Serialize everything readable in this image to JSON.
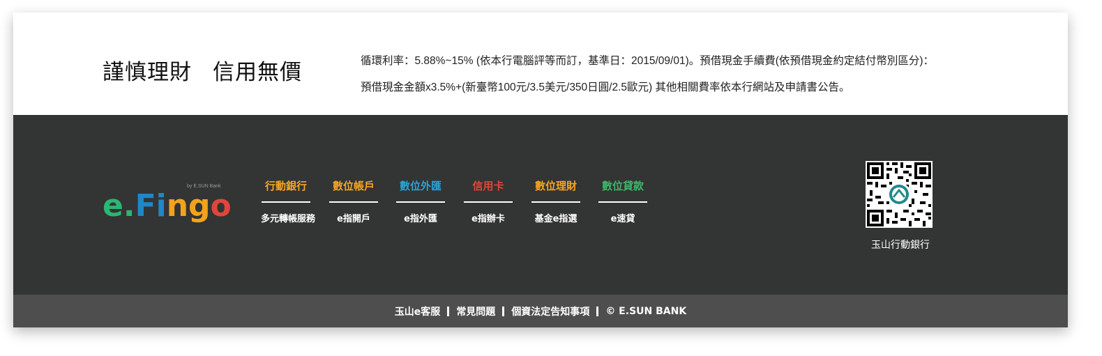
{
  "notice": {
    "slogan_left": "謹慎理財",
    "slogan_right": "信用無價",
    "rate_line1": "循環利率：5.88%~15% (依本行電腦評等而訂，基準日：2015/09/01)。預借現金手續費(依預借現金約定結付幣別區分)：",
    "rate_line2": "預借現金金額x3.5%+(新臺幣100元/3.5美元/350日圓/2.5歐元) 其他相關費率依本行網站及申請書公告。"
  },
  "logo": {
    "subtitle": "by E.SUN Bank",
    "letters": [
      "e",
      ".",
      "F",
      "i",
      "n",
      "g",
      "o"
    ],
    "letter_colors": [
      "#2bb673",
      "#2bb673",
      "#1e88c8",
      "#1e88c8",
      "#f2a31b",
      "#f2a31b",
      "#e0463b"
    ]
  },
  "services": [
    {
      "title": "行動銀行",
      "sub": "多元轉帳服務",
      "color": "#f5a623"
    },
    {
      "title": "數位帳戶",
      "sub": "e指開戶",
      "color": "#f5a623"
    },
    {
      "title": "數位外匯",
      "sub": "e指外匯",
      "color": "#29a3d9"
    },
    {
      "title": "信用卡",
      "sub": "e指辦卡",
      "color": "#e0463b"
    },
    {
      "title": "數位理財",
      "sub": "基金e指選",
      "color": "#f5a623"
    },
    {
      "title": "數位貸款",
      "sub": "e速貸",
      "color": "#3db86a"
    }
  ],
  "qr": {
    "icon": "qr-code-icon",
    "label": "玉山行動銀行"
  },
  "bottom_links": [
    "玉山e客服",
    "常見問題",
    "個資法定告知事項",
    "© E.SUN BANK"
  ]
}
